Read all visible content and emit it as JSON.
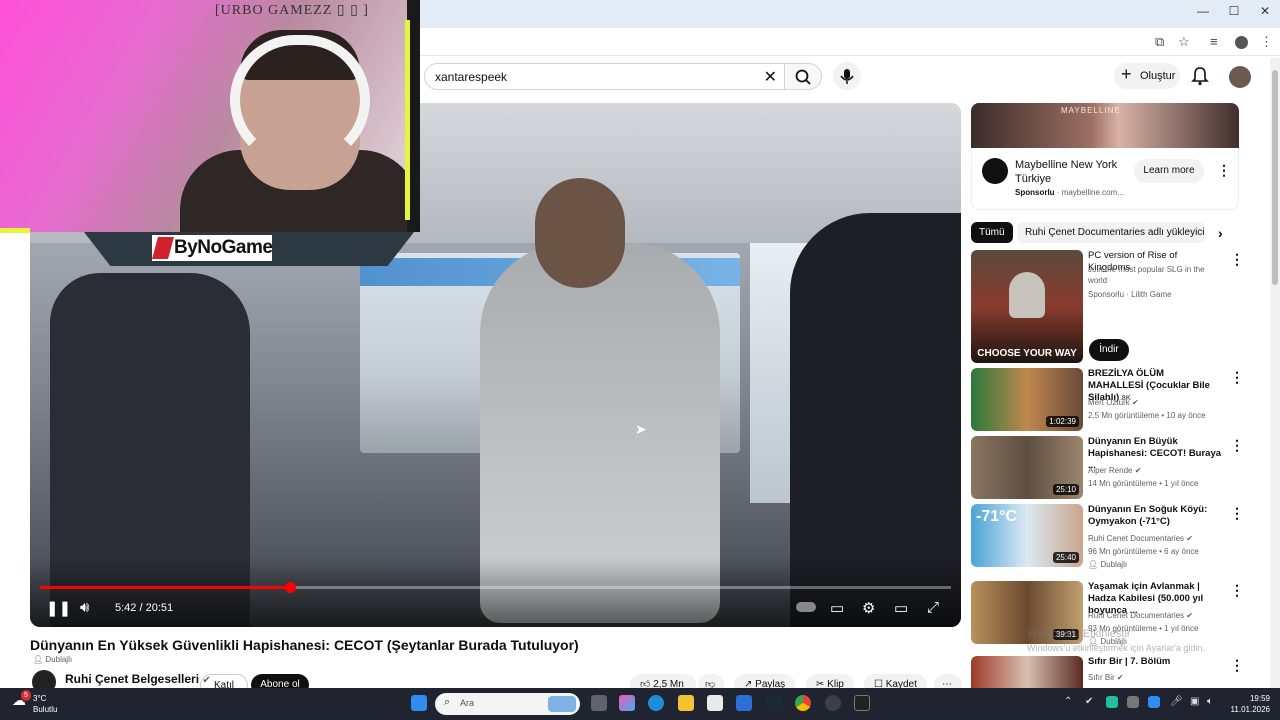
{
  "browser": {
    "window_controls": [
      "—",
      "☐",
      "✕"
    ]
  },
  "header": {
    "search_query": "xantarespeek",
    "create_label": "Oluştur"
  },
  "player": {
    "time": "5:42 / 20:51",
    "progress": 0.274
  },
  "overlay": {
    "cam_title": "[URBO GAMEZZ ▯ ▯ ]",
    "logo_text": "ByNoGame"
  },
  "video": {
    "title": "Dünyanın En Yüksek Güvenlikli Hapishanesi: CECOT (Şeytanlar Burada Tutuluyor)",
    "dub_label": "Dublajlı",
    "channel_name": "Ruhi Çenet Belgeselleri",
    "join_label": "Katıl",
    "subscribe_label": "Abone ol",
    "likes": "2,5 Mn",
    "share_label": "Paylaş",
    "clip_label": "Klip",
    "save_label": "Kaydet"
  },
  "ad": {
    "banner_brand": "MAYBELLINE",
    "title": "Maybelline New York Türkiye",
    "sponsored": "Sponsorlu",
    "domain": "maybelline.com...",
    "learn_more": "Learn more"
  },
  "chips": [
    "Tümü",
    "Ruhi Çenet Documentaries adlı yükleyicid"
  ],
  "recommendations": [
    {
      "title": "PC version of Rise of Kingdoms",
      "desc": "Join the most popular SLG in the world",
      "channel": "Sponsorlu · Lilith Game",
      "install": "İndir",
      "thumb_text": "CHOOSE YOUR WAY"
    },
    {
      "title": "BREZİLYA ÖLÜM MAHALLESİ (Çocuklar Bile Silahlı)",
      "title_suffix": "8K",
      "channel": "Mert Öztürk",
      "meta": "2,5 Mn görüntüleme • 10 ay önce",
      "duration": "1:02:39"
    },
    {
      "title": "Dünyanın En Büyük Hapishanesi: CECOT! Buraya ...",
      "channel": "Alper Rende",
      "meta": "14 Mn görüntüleme • 1 yıl önce",
      "duration": "25:10"
    },
    {
      "title": "Dünyanın En Soğuk Köyü: Oymyakon (-71°C)",
      "channel": "Ruhi Cenet Documentaries",
      "meta": "96 Mn görüntüleme • 6 ay önce",
      "dub": "Dublajlı",
      "duration": "25:40",
      "thumb_text": "-71°C"
    },
    {
      "title": "Yaşamak için Avlanmak | Hadza Kabilesi (50.000 yıl boyunca ...",
      "channel": "Ruhi Cenet Documentaries",
      "meta": "93 Mn görüntüleme • 1 yıl önce",
      "dub": "Dublajlı",
      "duration": "39:31"
    },
    {
      "title": "Sıfır Bir | 7. Bölüm",
      "channel": "Sıfır Bir",
      "meta": ""
    }
  ],
  "watermark": {
    "line1": "Windows'u Etkinleştir",
    "line2": "Windows'u etkinleştirmek için Ayarlar'a gidin."
  },
  "taskbar": {
    "temp": "3°C",
    "weather": "Bulutlu",
    "search_placeholder": "Ara",
    "time": "19:59",
    "date": "11.01.2026",
    "weather_badge": "5"
  },
  "colors": {
    "accent_red": "#ff0000",
    "yt_black": "#0f0f0f",
    "taskbar": "#1f2430"
  }
}
